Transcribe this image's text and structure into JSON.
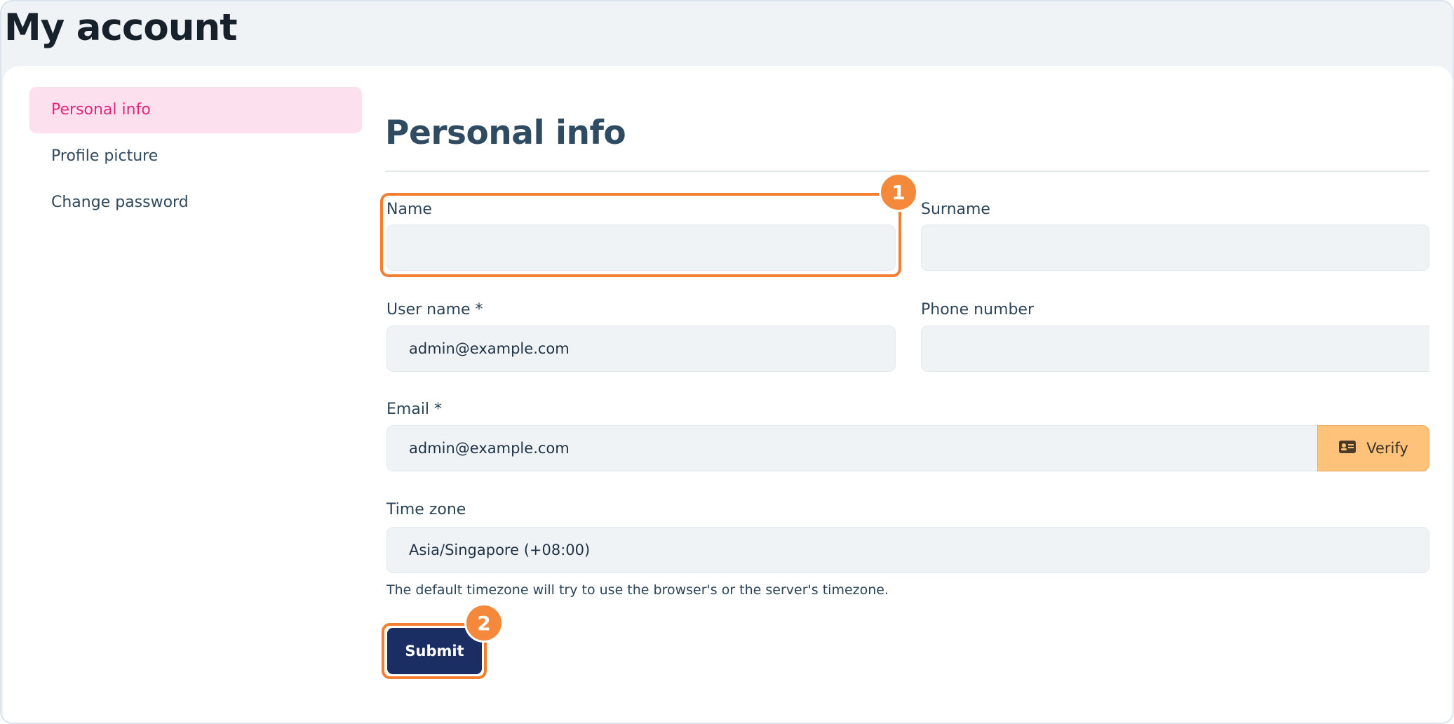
{
  "page": {
    "title": "My account"
  },
  "sidebar": {
    "items": [
      {
        "label": "Personal info"
      },
      {
        "label": "Profile picture"
      },
      {
        "label": "Change password"
      }
    ]
  },
  "form": {
    "section_title": "Personal info",
    "name": {
      "label": "Name",
      "value": ""
    },
    "surname": {
      "label": "Surname",
      "value": ""
    },
    "username": {
      "label": "User name *",
      "value": "admin@example.com"
    },
    "phone": {
      "label": "Phone number",
      "value": ""
    },
    "email": {
      "label": "Email *",
      "value": "admin@example.com",
      "verify_label": "Verify",
      "verify_icon": "id-card-icon"
    },
    "timezone": {
      "label": "Time zone",
      "value": "Asia/Singapore (+08:00)",
      "help": "The default timezone will try to use the browser's or the server's timezone."
    },
    "submit_label": "Submit"
  },
  "annotations": {
    "marker_1": "1",
    "marker_2": "2",
    "color": "#f57f30"
  },
  "colors": {
    "accent_pink": "#e0287a",
    "active_bg": "#fde0ee",
    "submit_bg": "#1a2e63",
    "verify_bg": "#fec27a"
  }
}
